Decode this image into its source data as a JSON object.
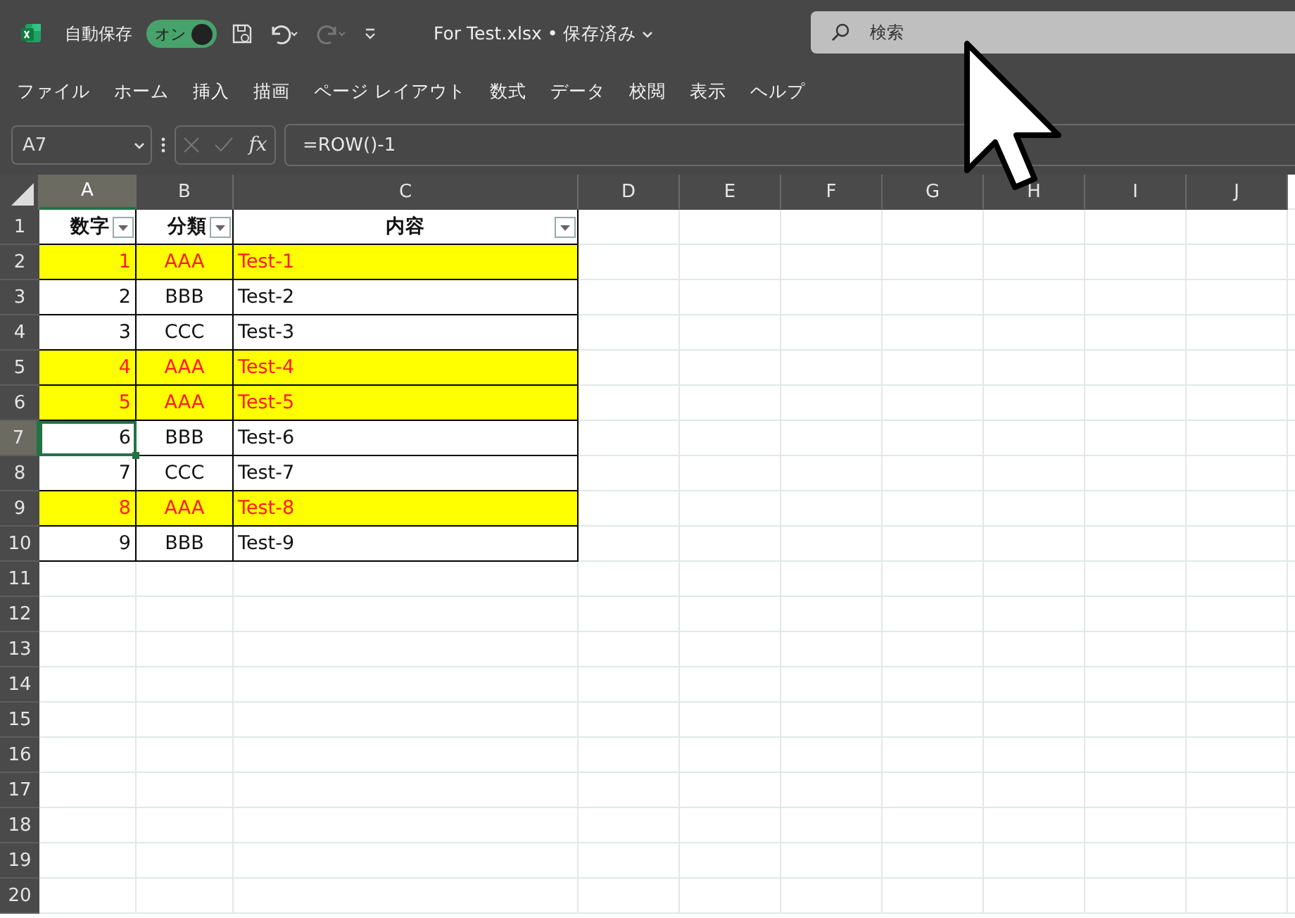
{
  "title_bar": {
    "autosave_label": "自動保存",
    "autosave_toggle": {
      "label": "オン",
      "on": true
    },
    "file_title": "For Test.xlsx • 保存済み",
    "search": {
      "placeholder": "検索"
    }
  },
  "menu": [
    "ファイル",
    "ホーム",
    "挿入",
    "描画",
    "ページ レイアウト",
    "数式",
    "データ",
    "校閲",
    "表示",
    "ヘルプ"
  ],
  "formula_bar": {
    "name_box": "A7",
    "fx": "fx",
    "formula": "=ROW()-1"
  },
  "sheet": {
    "columns": [
      {
        "label": "A",
        "selected": true
      },
      {
        "label": "B",
        "selected": false
      },
      {
        "label": "C",
        "selected": false
      },
      {
        "label": "D",
        "selected": false
      },
      {
        "label": "E",
        "selected": false
      },
      {
        "label": "F",
        "selected": false
      },
      {
        "label": "G",
        "selected": false
      },
      {
        "label": "H",
        "selected": false
      },
      {
        "label": "I",
        "selected": false
      },
      {
        "label": "J",
        "selected": false
      }
    ],
    "rows": [
      {
        "number": "1",
        "kind": "header",
        "selected": false,
        "cells": [
          "数字",
          "分類",
          "内容"
        ]
      },
      {
        "number": "2",
        "kind": "data",
        "selected": false,
        "highlighted": true,
        "cells": [
          "1",
          "AAA",
          "Test-1"
        ]
      },
      {
        "number": "3",
        "kind": "data",
        "selected": false,
        "highlighted": false,
        "cells": [
          "2",
          "BBB",
          "Test-2"
        ]
      },
      {
        "number": "4",
        "kind": "data",
        "selected": false,
        "highlighted": false,
        "cells": [
          "3",
          "CCC",
          "Test-3"
        ]
      },
      {
        "number": "5",
        "kind": "data",
        "selected": false,
        "highlighted": true,
        "cells": [
          "4",
          "AAA",
          "Test-4"
        ]
      },
      {
        "number": "6",
        "kind": "data",
        "selected": false,
        "highlighted": true,
        "cells": [
          "5",
          "AAA",
          "Test-5"
        ]
      },
      {
        "number": "7",
        "kind": "data",
        "selected": true,
        "highlighted": false,
        "cells": [
          "6",
          "BBB",
          "Test-6"
        ]
      },
      {
        "number": "8",
        "kind": "data",
        "selected": false,
        "highlighted": false,
        "cells": [
          "7",
          "CCC",
          "Test-7"
        ]
      },
      {
        "number": "9",
        "kind": "data",
        "selected": false,
        "highlighted": true,
        "cells": [
          "8",
          "AAA",
          "Test-8"
        ]
      },
      {
        "number": "10",
        "kind": "data",
        "selected": false,
        "highlighted": false,
        "cells": [
          "9",
          "BBB",
          "Test-9"
        ]
      },
      {
        "number": "11",
        "kind": "empty",
        "selected": false
      },
      {
        "number": "12",
        "kind": "empty",
        "selected": false
      },
      {
        "number": "13",
        "kind": "empty",
        "selected": false
      },
      {
        "number": "14",
        "kind": "empty",
        "selected": false
      },
      {
        "number": "15",
        "kind": "empty",
        "selected": false
      },
      {
        "number": "16",
        "kind": "empty",
        "selected": false
      },
      {
        "number": "17",
        "kind": "empty",
        "selected": false
      },
      {
        "number": "18",
        "kind": "empty",
        "selected": false
      },
      {
        "number": "19",
        "kind": "empty",
        "selected": false
      },
      {
        "number": "20",
        "kind": "empty",
        "selected": false
      }
    ]
  }
}
